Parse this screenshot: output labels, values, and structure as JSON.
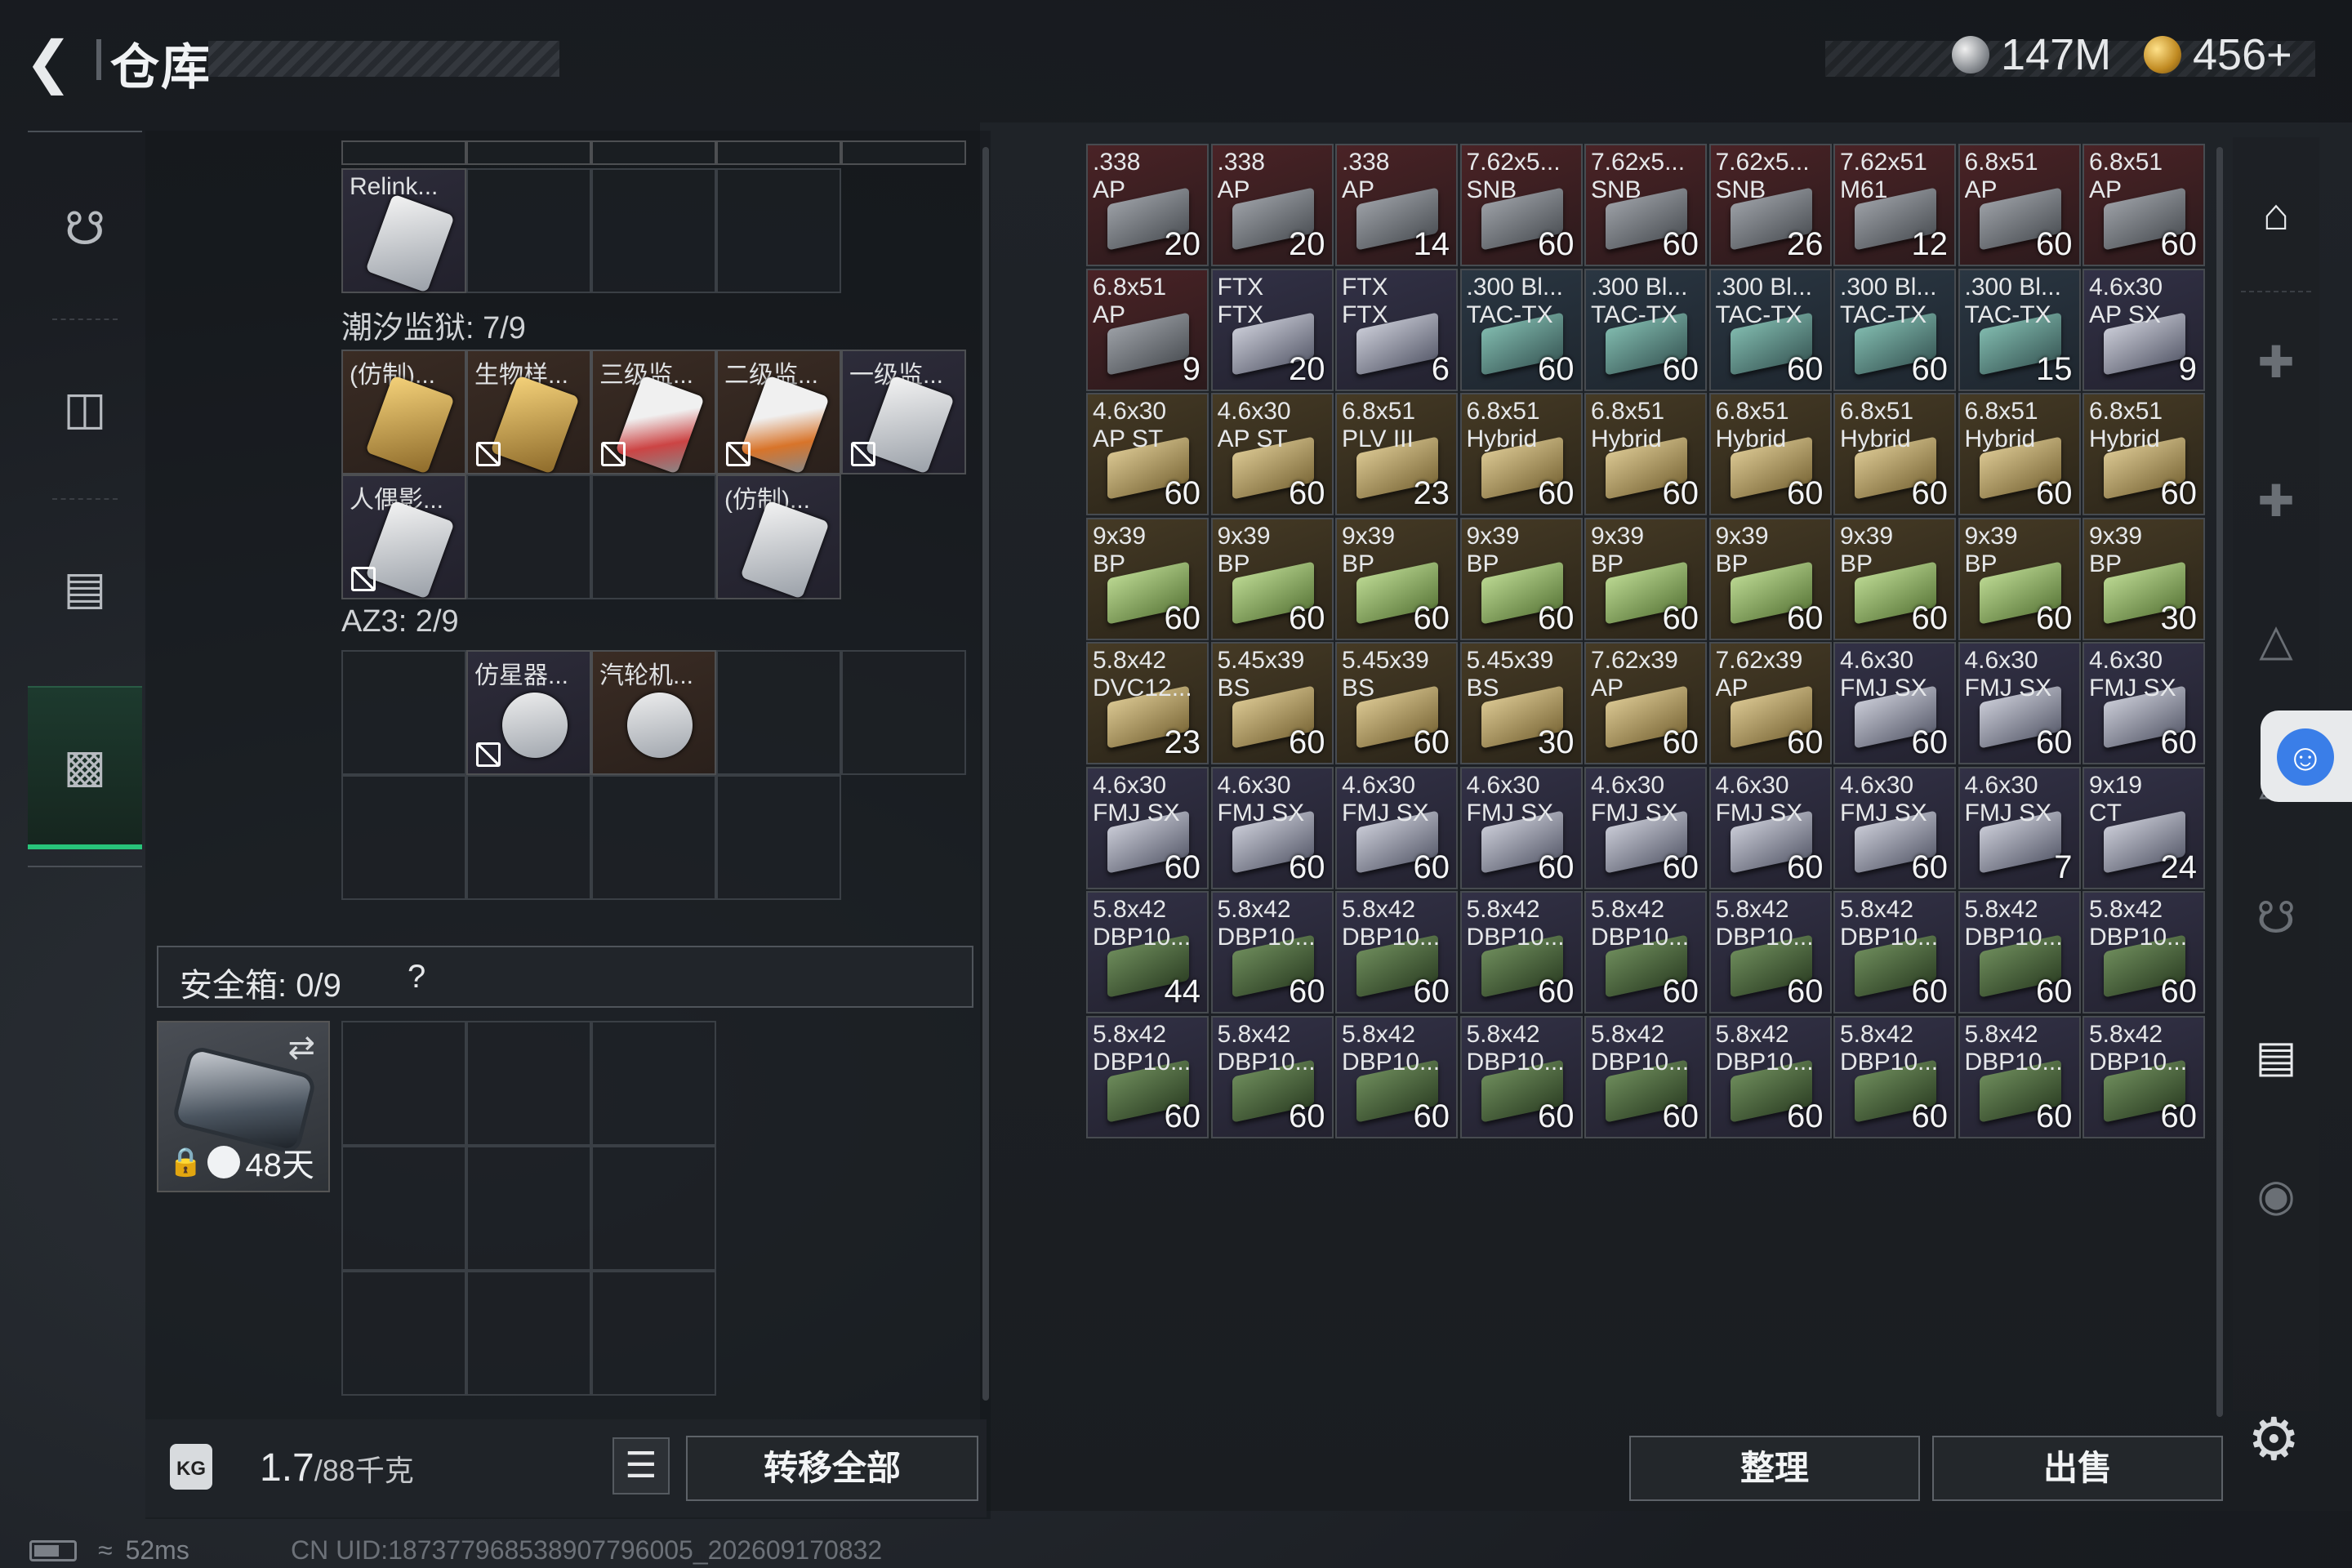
{
  "header": {
    "title": "仓库",
    "currency": [
      {
        "icon": "silver-coin-icon",
        "value": "147M"
      },
      {
        "icon": "gold-coin-icon",
        "value": "456+"
      }
    ]
  },
  "left_nav": {
    "items": [
      "gun-icon",
      "backpack-icon",
      "vest-icon",
      "toolbox-icon"
    ],
    "active": 3
  },
  "storage": {
    "top_item": {
      "name": "Relink..."
    },
    "sections": [
      {
        "label": "潮汐监狱: 7/9",
        "items": [
          "(仿制)...",
          "生物样...",
          "三级监...",
          "二级监...",
          "一级监...",
          "人偶影...",
          "(仿制)..."
        ]
      },
      {
        "label": "AZ3: 2/9",
        "items": [
          "仿星器...",
          "汽轮机..."
        ]
      }
    ],
    "safebox": {
      "label": "安全箱: 0/9",
      "help": "?",
      "timer": "48天"
    },
    "weight": {
      "current": "1.7",
      "capacity": "/88千克"
    },
    "transfer_all": "转移全部"
  },
  "inventory": [
    {
      "n1": ".338",
      "n2": "AP",
      "qty": "20",
      "tier": "t-red"
    },
    {
      "n1": ".338",
      "n2": "AP",
      "qty": "20",
      "tier": "t-red"
    },
    {
      "n1": ".338",
      "n2": "AP",
      "qty": "14",
      "tier": "t-red"
    },
    {
      "n1": "7.62x5...",
      "n2": "SNB",
      "qty": "60",
      "tier": "t-red"
    },
    {
      "n1": "7.62x5...",
      "n2": "SNB",
      "qty": "60",
      "tier": "t-red"
    },
    {
      "n1": "7.62x5...",
      "n2": "SNB",
      "qty": "26",
      "tier": "t-red"
    },
    {
      "n1": "7.62x51",
      "n2": "M61",
      "qty": "12",
      "tier": "t-red"
    },
    {
      "n1": "6.8x51",
      "n2": "AP",
      "qty": "60",
      "tier": "t-red"
    },
    {
      "n1": "6.8x51",
      "n2": "AP",
      "qty": "60",
      "tier": "t-red"
    },
    {
      "n1": "6.8x51",
      "n2": "AP",
      "qty": "9",
      "tier": "t-red"
    },
    {
      "n1": "FTX",
      "n2": "FTX",
      "qty": "20",
      "tier": "t-purple"
    },
    {
      "n1": "FTX",
      "n2": "FTX",
      "qty": "6",
      "tier": "t-purple"
    },
    {
      "n1": ".300 Bl...",
      "n2": "TAC-TX",
      "qty": "60",
      "tier": "t-blue"
    },
    {
      "n1": ".300 Bl...",
      "n2": "TAC-TX",
      "qty": "60",
      "tier": "t-blue"
    },
    {
      "n1": ".300 Bl...",
      "n2": "TAC-TX",
      "qty": "60",
      "tier": "t-blue"
    },
    {
      "n1": ".300 Bl...",
      "n2": "TAC-TX",
      "qty": "60",
      "tier": "t-blue"
    },
    {
      "n1": ".300 Bl...",
      "n2": "TAC-TX",
      "qty": "15",
      "tier": "t-blue"
    },
    {
      "n1": "4.6x30",
      "n2": "AP SX",
      "qty": "9",
      "tier": "t-purple"
    },
    {
      "n1": "4.6x30",
      "n2": "AP ST",
      "qty": "60",
      "tier": "t-gold"
    },
    {
      "n1": "4.6x30",
      "n2": "AP ST",
      "qty": "60",
      "tier": "t-gold"
    },
    {
      "n1": "6.8x51",
      "n2": "PLV III",
      "qty": "23",
      "tier": "t-gold"
    },
    {
      "n1": "6.8x51",
      "n2": "Hybrid",
      "qty": "60",
      "tier": "t-gold"
    },
    {
      "n1": "6.8x51",
      "n2": "Hybrid",
      "qty": "60",
      "tier": "t-gold"
    },
    {
      "n1": "6.8x51",
      "n2": "Hybrid",
      "qty": "60",
      "tier": "t-gold"
    },
    {
      "n1": "6.8x51",
      "n2": "Hybrid",
      "qty": "60",
      "tier": "t-gold"
    },
    {
      "n1": "6.8x51",
      "n2": "Hybrid",
      "qty": "60",
      "tier": "t-gold"
    },
    {
      "n1": "6.8x51",
      "n2": "Hybrid",
      "qty": "60",
      "tier": "t-gold"
    },
    {
      "n1": "9x39",
      "n2": "BP",
      "qty": "60",
      "tier": "t-gold"
    },
    {
      "n1": "9x39",
      "n2": "BP",
      "qty": "60",
      "tier": "t-gold"
    },
    {
      "n1": "9x39",
      "n2": "BP",
      "qty": "60",
      "tier": "t-gold"
    },
    {
      "n1": "9x39",
      "n2": "BP",
      "qty": "60",
      "tier": "t-gold"
    },
    {
      "n1": "9x39",
      "n2": "BP",
      "qty": "60",
      "tier": "t-gold"
    },
    {
      "n1": "9x39",
      "n2": "BP",
      "qty": "60",
      "tier": "t-gold"
    },
    {
      "n1": "9x39",
      "n2": "BP",
      "qty": "60",
      "tier": "t-gold"
    },
    {
      "n1": "9x39",
      "n2": "BP",
      "qty": "60",
      "tier": "t-gold"
    },
    {
      "n1": "9x39",
      "n2": "BP",
      "qty": "30",
      "tier": "t-gold"
    },
    {
      "n1": "5.8x42",
      "n2": "DVC12...",
      "qty": "23",
      "tier": "t-gold"
    },
    {
      "n1": "5.45x39",
      "n2": "BS",
      "qty": "60",
      "tier": "t-gold"
    },
    {
      "n1": "5.45x39",
      "n2": "BS",
      "qty": "60",
      "tier": "t-gold"
    },
    {
      "n1": "5.45x39",
      "n2": "BS",
      "qty": "30",
      "tier": "t-gold"
    },
    {
      "n1": "7.62x39",
      "n2": "AP",
      "qty": "60",
      "tier": "t-gold"
    },
    {
      "n1": "7.62x39",
      "n2": "AP",
      "qty": "60",
      "tier": "t-gold"
    },
    {
      "n1": "4.6x30",
      "n2": "FMJ SX",
      "qty": "60",
      "tier": "t-purple"
    },
    {
      "n1": "4.6x30",
      "n2": "FMJ SX",
      "qty": "60",
      "tier": "t-purple"
    },
    {
      "n1": "4.6x30",
      "n2": "FMJ SX",
      "qty": "60",
      "tier": "t-purple"
    },
    {
      "n1": "4.6x30",
      "n2": "FMJ SX",
      "qty": "60",
      "tier": "t-purple"
    },
    {
      "n1": "4.6x30",
      "n2": "FMJ SX",
      "qty": "60",
      "tier": "t-purple"
    },
    {
      "n1": "4.6x30",
      "n2": "FMJ SX",
      "qty": "60",
      "tier": "t-purple"
    },
    {
      "n1": "4.6x30",
      "n2": "FMJ SX",
      "qty": "60",
      "tier": "t-purple"
    },
    {
      "n1": "4.6x30",
      "n2": "FMJ SX",
      "qty": "60",
      "tier": "t-purple"
    },
    {
      "n1": "4.6x30",
      "n2": "FMJ SX",
      "qty": "60",
      "tier": "t-purple"
    },
    {
      "n1": "4.6x30",
      "n2": "FMJ SX",
      "qty": "60",
      "tier": "t-purple"
    },
    {
      "n1": "4.6x30",
      "n2": "FMJ SX",
      "qty": "7",
      "tier": "t-purple"
    },
    {
      "n1": "9x19",
      "n2": "CT",
      "qty": "24",
      "tier": "t-purple"
    },
    {
      "n1": "5.8x42",
      "n2": "DBP10...",
      "qty": "44",
      "tier": "t-purple"
    },
    {
      "n1": "5.8x42",
      "n2": "DBP10...",
      "qty": "60",
      "tier": "t-purple"
    },
    {
      "n1": "5.8x42",
      "n2": "DBP10...",
      "qty": "60",
      "tier": "t-purple"
    },
    {
      "n1": "5.8x42",
      "n2": "DBP10...",
      "qty": "60",
      "tier": "t-purple"
    },
    {
      "n1": "5.8x42",
      "n2": "DBP10...",
      "qty": "60",
      "tier": "t-purple"
    },
    {
      "n1": "5.8x42",
      "n2": "DBP10...",
      "qty": "60",
      "tier": "t-purple"
    },
    {
      "n1": "5.8x42",
      "n2": "DBP10...",
      "qty": "60",
      "tier": "t-purple"
    },
    {
      "n1": "5.8x42",
      "n2": "DBP10...",
      "qty": "60",
      "tier": "t-purple"
    },
    {
      "n1": "5.8x42",
      "n2": "DBP10...",
      "qty": "60",
      "tier": "t-purple"
    },
    {
      "n1": "5.8x42",
      "n2": "DBP10...",
      "qty": "60",
      "tier": "t-purple"
    },
    {
      "n1": "5.8x42",
      "n2": "DBP10...",
      "qty": "60",
      "tier": "t-purple"
    },
    {
      "n1": "5.8x42",
      "n2": "DBP10...",
      "qty": "60",
      "tier": "t-purple"
    },
    {
      "n1": "5.8x42",
      "n2": "DBP10...",
      "qty": "60",
      "tier": "t-purple"
    },
    {
      "n1": "5.8x42",
      "n2": "DBP10...",
      "qty": "60",
      "tier": "t-purple"
    },
    {
      "n1": "5.8x42",
      "n2": "DBP10...",
      "qty": "60",
      "tier": "t-purple"
    },
    {
      "n1": "5.8x42",
      "n2": "DBP10...",
      "qty": "60",
      "tier": "t-purple"
    },
    {
      "n1": "5.8x42",
      "n2": "DBP10...",
      "qty": "60",
      "tier": "t-purple"
    },
    {
      "n1": "5.8x42",
      "n2": "DBP10...",
      "qty": "60",
      "tier": "t-purple"
    }
  ],
  "actions": {
    "sort": "整理",
    "sell": "出售"
  },
  "status": {
    "ping": "52ms",
    "uid": "CN UID:187377968538907796005_202609170832"
  },
  "colors": {
    "accent_green": "#28c47a",
    "a11y_blue": "#3a7ee8"
  }
}
